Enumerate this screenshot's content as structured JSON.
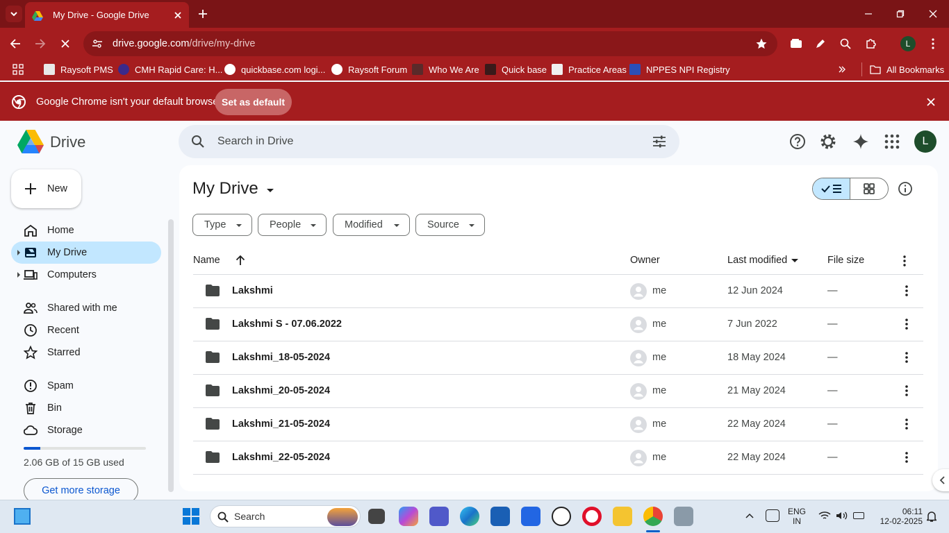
{
  "browser": {
    "tab_title": "My Drive - Google Drive",
    "url_host": "drive.google.com",
    "url_path": "/drive/my-drive",
    "profile_initial": "L",
    "bookmarks": [
      "Raysoft PMS",
      "CMH Rapid Care: H...",
      "quickbase.com logi...",
      "Raysoft Forum",
      "Who We Are",
      "Quick base",
      "Practice Areas",
      "NPPES NPI Registry"
    ],
    "all_bookmarks": "All Bookmarks",
    "infobar_text": "Google Chrome isn't your default browser",
    "infobar_button": "Set as default"
  },
  "drive": {
    "app_name": "Drive",
    "search_placeholder": "Search in Drive",
    "avatar_initial": "L",
    "new_label": "New",
    "nav": [
      "Home",
      "My Drive",
      "Computers",
      "Shared with me",
      "Recent",
      "Starred",
      "Spam",
      "Bin",
      "Storage"
    ],
    "storage_used": "2.06 GB of 15 GB used",
    "storage_fraction": 0.137,
    "get_more": "Get more storage",
    "title": "My Drive",
    "filters": [
      "Type",
      "People",
      "Modified",
      "Source"
    ],
    "columns": {
      "name": "Name",
      "owner": "Owner",
      "modified": "Last modified",
      "size": "File size"
    },
    "files": [
      {
        "name": "Lakshmi",
        "owner": "me",
        "modified": "12 Jun 2024",
        "size": "—"
      },
      {
        "name": "Lakshmi S - 07.06.2022",
        "owner": "me",
        "modified": "7 Jun 2022",
        "size": "—"
      },
      {
        "name": "Lakshmi_18-05-2024",
        "owner": "me",
        "modified": "18 May 2024",
        "size": "—"
      },
      {
        "name": "Lakshmi_20-05-2024",
        "owner": "me",
        "modified": "21 May 2024",
        "size": "—"
      },
      {
        "name": "Lakshmi_21-05-2024",
        "owner": "me",
        "modified": "22 May 2024",
        "size": "—"
      },
      {
        "name": "Lakshmi_22-05-2024",
        "owner": "me",
        "modified": "22 May 2024",
        "size": "—"
      }
    ]
  },
  "taskbar": {
    "search_label": "Search",
    "lang": "ENG",
    "region": "IN",
    "time": "06:11",
    "date": "12-02-2025"
  },
  "colors": {
    "chrome_dark": "#7a1416",
    "chrome": "#a51d1f",
    "accent": "#0b57d0",
    "selected": "#c2e7ff"
  }
}
